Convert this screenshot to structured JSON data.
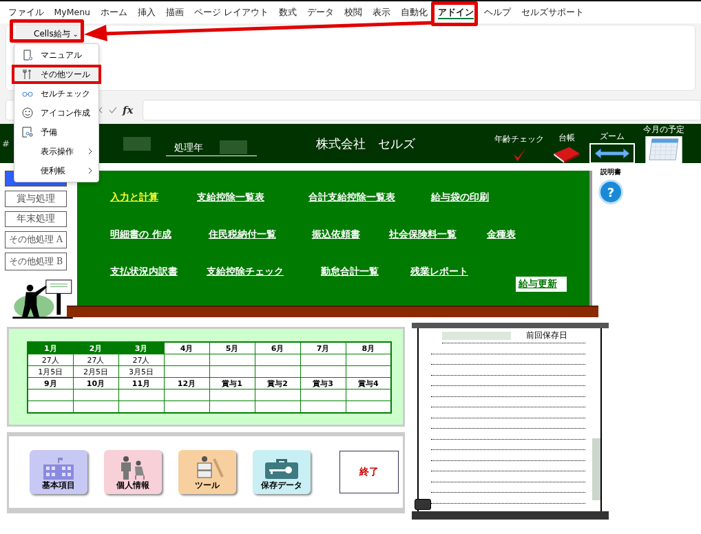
{
  "menu_tabs": [
    {
      "label": "ファイル",
      "selected": false
    },
    {
      "label": "MyMenu",
      "selected": false
    },
    {
      "label": "ホーム",
      "selected": false
    },
    {
      "label": "挿入",
      "selected": false
    },
    {
      "label": "描画",
      "selected": false
    },
    {
      "label": "ページ レイアウト",
      "selected": false
    },
    {
      "label": "数式",
      "selected": false
    },
    {
      "label": "データ",
      "selected": false
    },
    {
      "label": "校閲",
      "selected": false
    },
    {
      "label": "表示",
      "selected": false
    },
    {
      "label": "自動化",
      "selected": false
    },
    {
      "label": "アドイン",
      "selected": true
    },
    {
      "label": "ヘルプ",
      "selected": false
    },
    {
      "label": "セルズサポート",
      "selected": false
    }
  ],
  "ribbon_button": {
    "label": "Cells給与",
    "caret": "⌄"
  },
  "dropdown": [
    {
      "label": "マニュアル",
      "selected": false
    },
    {
      "label": "その他ツール",
      "selected": true
    },
    {
      "label": "セルチェック",
      "selected": false
    },
    {
      "label": "アイコン作成",
      "selected": false
    },
    {
      "label": "予備",
      "selected": false
    },
    {
      "label": "表示操作",
      "submenu": true,
      "selected": false
    },
    {
      "label": "便利帳",
      "submenu": true,
      "selected": false
    }
  ],
  "formula_bar": {
    "fx": "fx"
  },
  "header": {
    "row_mark": "#",
    "year_label": "処理年",
    "company": "株式会社　セルズ",
    "tools": [
      {
        "label": "年齢チェック"
      },
      {
        "label": "台帳"
      },
      {
        "label": "ズーム"
      },
      {
        "label": "今月の予定"
      }
    ]
  },
  "sidebar": [
    {
      "selected": true
    },
    {
      "label": "賞与処理",
      "selected": false
    },
    {
      "label": "年末処理",
      "selected": false
    },
    {
      "label": "その他処理 A",
      "selected": false
    },
    {
      "label": "その他処理 B",
      "selected": false
    }
  ],
  "help": {
    "label": "説明書",
    "mark": "?"
  },
  "board": {
    "rows": [
      [
        {
          "label": "入力と計算",
          "highlighted": true
        },
        {
          "label": "支給控除一覧表",
          "highlighted": false
        },
        {
          "label": "合計支給控除一覧表",
          "highlighted": false
        },
        {
          "label": "給与袋の印刷",
          "highlighted": false
        }
      ],
      [
        {
          "label": "明細書の 作成",
          "highlighted": false
        },
        {
          "label": "住民税納付一覧",
          "highlighted": false
        },
        {
          "label": "振込依頼書",
          "highlighted": false
        },
        {
          "label": "社会保険料一覧",
          "highlighted": false
        },
        {
          "label": "金種表",
          "highlighted": false
        }
      ],
      [
        {
          "label": "支払状況内訳書",
          "highlighted": false
        },
        {
          "label": "支給控除チェック",
          "highlighted": false
        },
        {
          "label": "勤怠合計一覧",
          "highlighted": false
        },
        {
          "label": "残業レポート",
          "highlighted": false
        }
      ]
    ],
    "update_button": "給与更新"
  },
  "calendar": [
    [
      {
        "label": "1月",
        "done": true,
        "count": "27人",
        "date": "1月5日"
      },
      {
        "label": "2月",
        "done": true,
        "count": "27人",
        "date": "2月5日"
      },
      {
        "label": "3月",
        "done": true,
        "count": "27人",
        "date": "3月5日"
      },
      {
        "label": "4月",
        "done": false
      },
      {
        "label": "5月",
        "done": false
      },
      {
        "label": "6月",
        "done": false
      },
      {
        "label": "7月",
        "done": false
      },
      {
        "label": "8月",
        "done": false
      }
    ],
    [
      {
        "label": "9月",
        "done": false
      },
      {
        "label": "10月",
        "done": false
      },
      {
        "label": "11月",
        "done": false
      },
      {
        "label": "12月",
        "done": false
      },
      {
        "label": "賞与1",
        "done": false
      },
      {
        "label": "賞与2",
        "done": false
      },
      {
        "label": "賞与3",
        "done": false
      },
      {
        "label": "賞与4",
        "done": false
      }
    ]
  ],
  "tools": [
    {
      "label": "基本項目"
    },
    {
      "label": "個人情報"
    },
    {
      "label": "ツール"
    },
    {
      "label": "保存データ"
    }
  ],
  "exit_button": "終了",
  "save_panel": {
    "label": "前回保存日"
  }
}
